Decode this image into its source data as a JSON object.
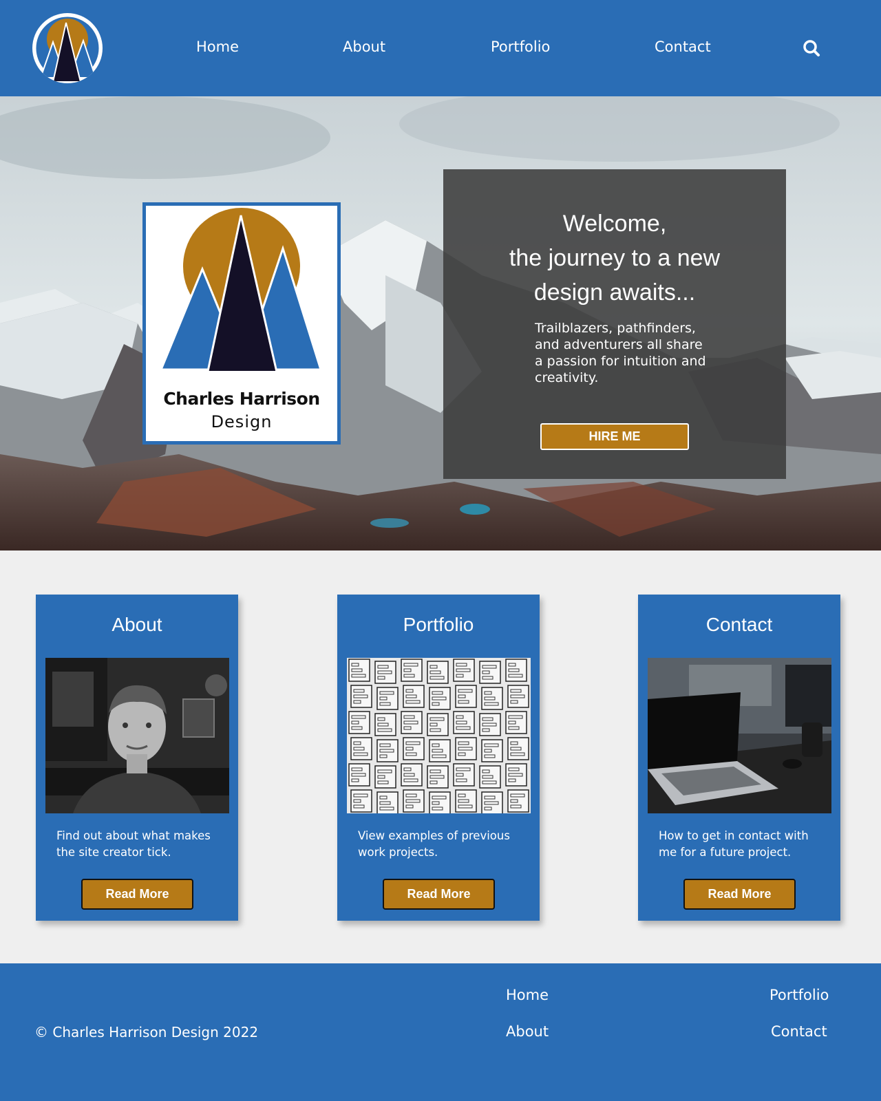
{
  "colors": {
    "brand_blue": "#2a6db5",
    "accent_gold": "#b67a17",
    "page_bg": "#efefef"
  },
  "header": {
    "logo_icon": "mountain-sun-logo-icon",
    "nav": [
      {
        "label": "Home"
      },
      {
        "label": "About"
      },
      {
        "label": "Portfolio"
      },
      {
        "label": "Contact"
      }
    ],
    "search_icon": "search-icon"
  },
  "hero": {
    "brand_name": "Charles Harrison",
    "brand_sub": "Design",
    "welcome_line1": "Welcome,",
    "welcome_line2": "the journey to a new",
    "welcome_line3": "design awaits...",
    "intro_text": "Trailblazers, pathfinders, and adventurers all share a passion for intuition and creativity.",
    "hire_button": "HIRE ME"
  },
  "cards": [
    {
      "title": "About",
      "text": "Find out about what makes the site creator tick.",
      "button": "Read More",
      "image": "portrait-photo"
    },
    {
      "title": "Portfolio",
      "text": "View examples of previous work projects.",
      "button": "Read More",
      "image": "wireframe-sketches-photo"
    },
    {
      "title": "Contact",
      "text": "How to get in contact with me for a future project.",
      "button": "Read More",
      "image": "laptop-desk-photo"
    }
  ],
  "footer": {
    "copyright": "© Charles Harrison Design 2022",
    "links": [
      {
        "label": "Home"
      },
      {
        "label": "Portfolio"
      },
      {
        "label": "About"
      },
      {
        "label": "Contact"
      }
    ]
  }
}
